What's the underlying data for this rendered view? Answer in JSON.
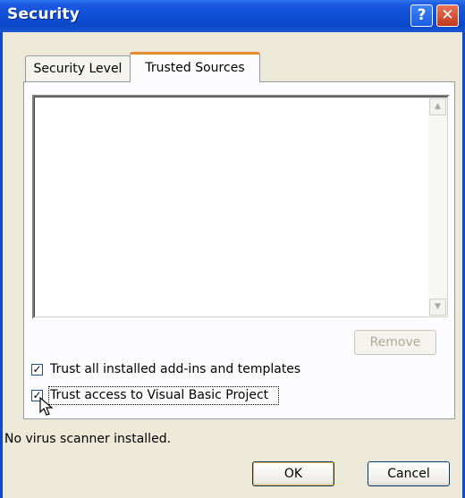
{
  "window": {
    "title": "Security",
    "help_glyph": "?",
    "close_glyph": "✕"
  },
  "tabs": [
    {
      "label": "Security Level",
      "selected": false
    },
    {
      "label": "Trusted Sources",
      "selected": true
    }
  ],
  "trusted_sources": {
    "list_items": [],
    "remove_label": "Remove",
    "remove_enabled": false
  },
  "options": {
    "trust_addins": {
      "label": "Trust all installed add-ins and templates",
      "checked": true
    },
    "trust_vba": {
      "label": "Trust access to Visual Basic Project",
      "checked": true
    }
  },
  "status": {
    "text": "No virus scanner installed."
  },
  "buttons": {
    "ok_label": "OK",
    "cancel_label": "Cancel"
  },
  "colors": {
    "titlebar": "#0f4fd4",
    "tab_highlight": "#e68b2c",
    "dialog_bg": "#ece9d8"
  }
}
